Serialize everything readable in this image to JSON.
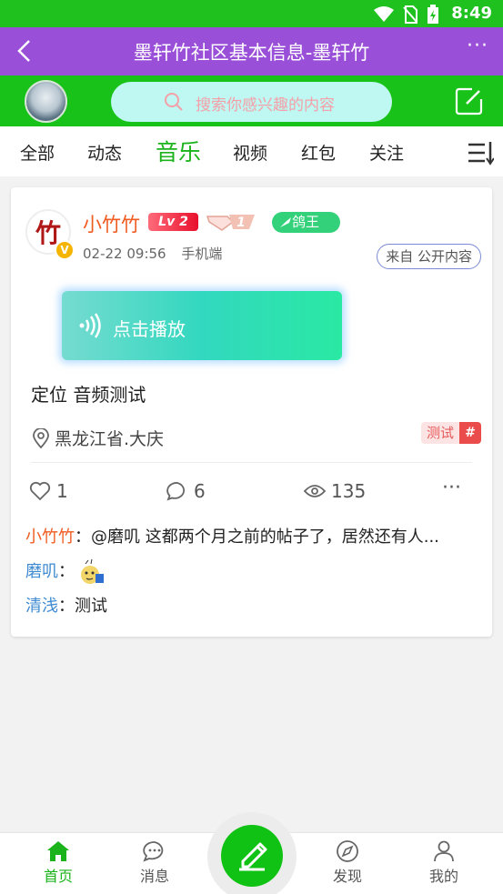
{
  "status_bar": {
    "time": "8:49",
    "icons": [
      "wifi-icon",
      "no-sim-icon",
      "battery-charging-icon"
    ]
  },
  "titlebar": {
    "title": "墨轩竹社区基本信息-墨轩竹",
    "more": "···"
  },
  "search": {
    "placeholder": "搜索你感兴趣的内容"
  },
  "tabs": [
    "全部",
    "动态",
    "音乐",
    "视频",
    "红包",
    "关注"
  ],
  "active_tab": "音乐",
  "post": {
    "author": "小竹竹",
    "avatar_text": "竹",
    "level": "Lv 2",
    "vip_level": "1",
    "title_badge": "鸽王",
    "date": "02-22 09:56",
    "device": "手机端",
    "source": "来自 公开内容",
    "audio_button": "点击播放",
    "content": "定位 音频测试",
    "location": "黑龙江省.大庆",
    "tag": "测试",
    "tag_symbol": "#",
    "likes": "1",
    "comments_count": "6",
    "views": "135",
    "more": "···"
  },
  "comments": [
    {
      "name": "小竹竹",
      "sep": "：",
      "text": "@磨叽 这都两个月之前的帖子了，居然还有人..."
    },
    {
      "name": "磨叽",
      "sep": "：",
      "text": ""
    },
    {
      "name": "清浅",
      "sep": "：",
      "text": "测试"
    }
  ],
  "bottom_nav": {
    "home": "首页",
    "messages": "消息",
    "discover": "发现",
    "mine": "我的"
  },
  "colors": {
    "status_green": "#1fc11f",
    "title_purple": "#9a4fd8",
    "accent_green": "#1bb31b",
    "author_orange": "#ef5b21",
    "comment_blue": "#3f8bd1"
  }
}
